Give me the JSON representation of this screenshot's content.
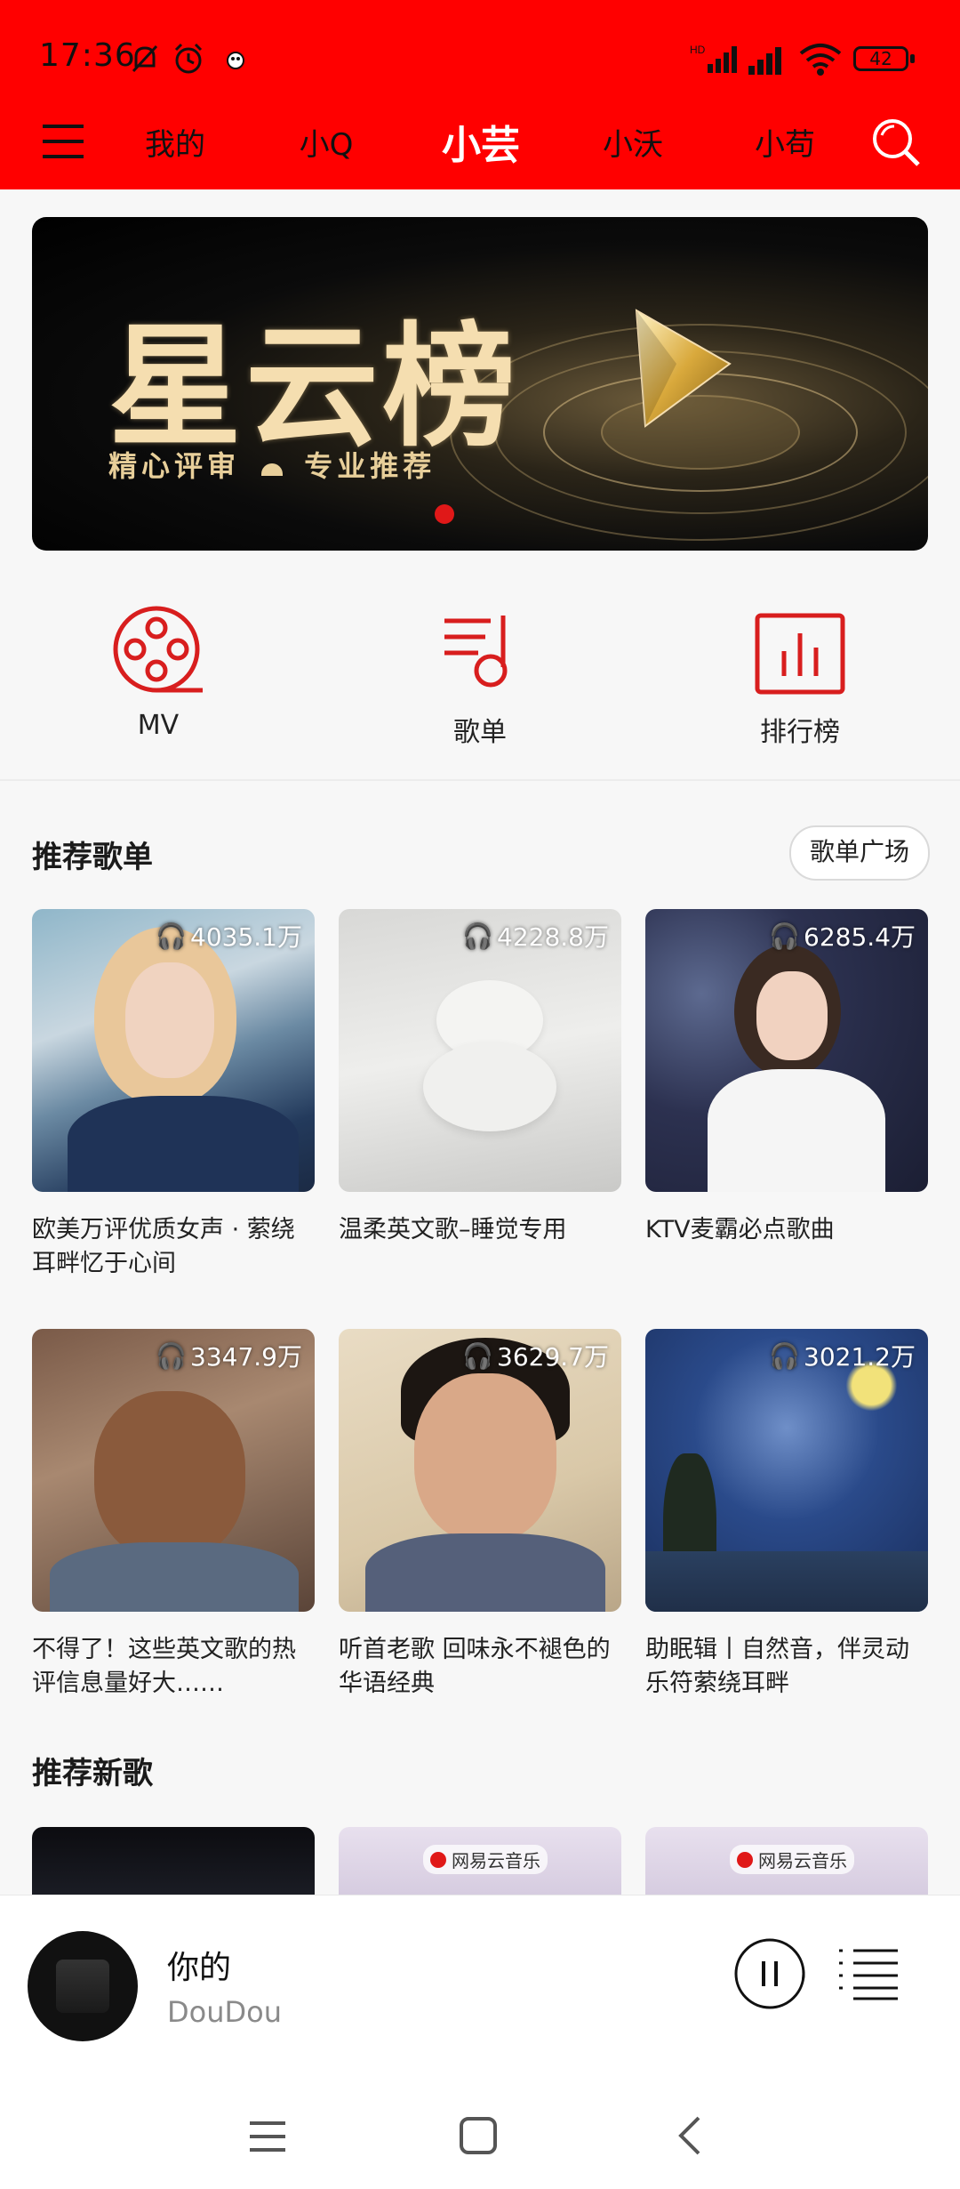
{
  "status_bar": {
    "time": "17:36",
    "battery": "42"
  },
  "nav": {
    "tabs": [
      "我的",
      "小Q",
      "小芸",
      "小沃",
      "小苟"
    ],
    "active": "小芸"
  },
  "banner": {
    "title": "星云榜",
    "subtitle_left": "精心评审",
    "subtitle_right": "专业推荐"
  },
  "shortcuts": [
    {
      "label": "MV",
      "icon": "film-reel-icon"
    },
    {
      "label": "歌单",
      "icon": "playlist-note-icon"
    },
    {
      "label": "排行榜",
      "icon": "chart-bars-icon"
    }
  ],
  "recommended_playlists": {
    "title": "推荐歌单",
    "more_label": "歌单广场",
    "items": [
      {
        "count": "4035.1万",
        "caption": "欧美万评优质女声 · 萦绕耳畔忆于心间"
      },
      {
        "count": "4228.8万",
        "caption": "温柔英文歌–睡觉专用"
      },
      {
        "count": "6285.4万",
        "caption": "KTV麦霸必点歌曲"
      },
      {
        "count": "3347.9万",
        "caption": "不得了！这些英文歌的热评信息量好大……"
      },
      {
        "count": "3629.7万",
        "caption": "听首老歌 回味永不褪色的华语经典"
      },
      {
        "count": "3021.2万",
        "caption": "助眠辑丨自然音，伴灵动乐符萦绕耳畔"
      }
    ]
  },
  "new_songs": {
    "title": "推荐新歌",
    "brand": "网易云音乐"
  },
  "player": {
    "song": "你的",
    "artist": "DouDou"
  },
  "colors": {
    "header": "#ff0000",
    "accent": "#e01818"
  }
}
